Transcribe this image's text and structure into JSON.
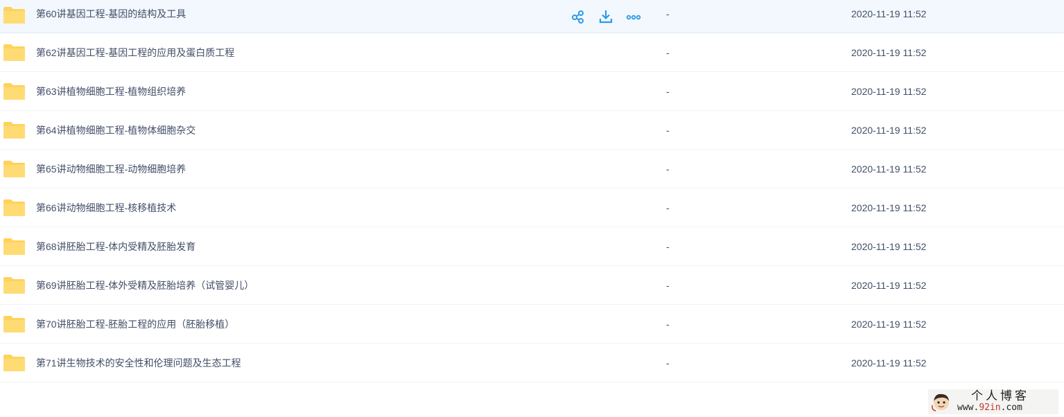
{
  "colors": {
    "folder": "#ffd25c",
    "action_icon": "#2b9be6",
    "text": "#424e67"
  },
  "file_list": {
    "rows": [
      {
        "name": "第60讲基因工程-基因的结构及工具",
        "size": "-",
        "modified": "2020-11-19 11:52"
      },
      {
        "name": "第62讲基因工程-基因工程的应用及蛋白质工程",
        "size": "-",
        "modified": "2020-11-19 11:52"
      },
      {
        "name": "第63讲植物细胞工程-植物组织培养",
        "size": "-",
        "modified": "2020-11-19 11:52"
      },
      {
        "name": "第64讲植物细胞工程-植物体细胞杂交",
        "size": "-",
        "modified": "2020-11-19 11:52"
      },
      {
        "name": "第65讲动物细胞工程-动物细胞培养",
        "size": "-",
        "modified": "2020-11-19 11:52"
      },
      {
        "name": "第66讲动物细胞工程-核移植技术",
        "size": "-",
        "modified": "2020-11-19 11:52"
      },
      {
        "name": "第68讲胚胎工程-体内受精及胚胎发育",
        "size": "-",
        "modified": "2020-11-19 11:52"
      },
      {
        "name": "第69讲胚胎工程-体外受精及胚胎培养（试管婴儿）",
        "size": "-",
        "modified": "2020-11-19 11:52"
      },
      {
        "name": "第70讲胚胎工程-胚胎工程的应用（胚胎移植）",
        "size": "-",
        "modified": "2020-11-19 11:52"
      },
      {
        "name": "第71讲生物技术的安全性和伦理问题及生态工程",
        "size": "-",
        "modified": "2020-11-19 11:52"
      }
    ],
    "row_actions": [
      "share-icon",
      "download-icon",
      "more-icon"
    ]
  },
  "watermark": {
    "title": "个人博客",
    "url_prefix": "www.",
    "url_accent": "92in",
    "url_suffix": ".com"
  }
}
